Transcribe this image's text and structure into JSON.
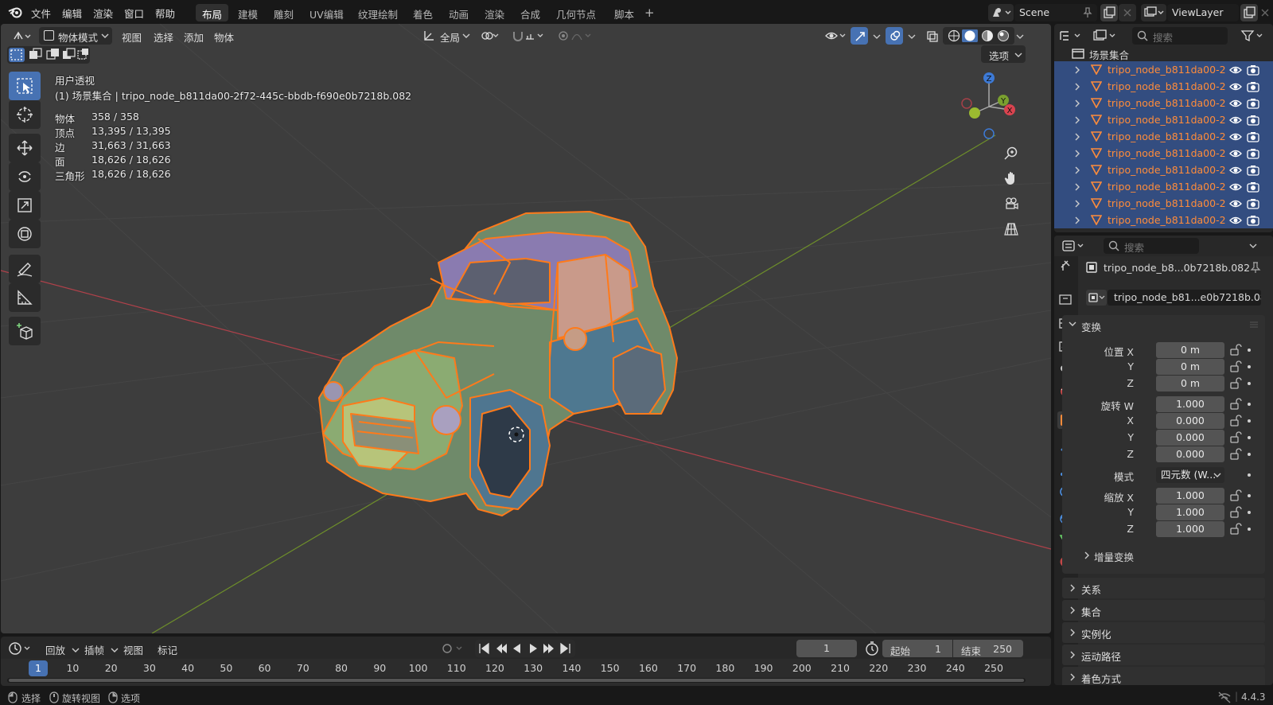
{
  "topbar": {
    "menus": [
      "文件",
      "编辑",
      "渲染",
      "窗口",
      "帮助"
    ],
    "workspaces": [
      "布局",
      "建模",
      "雕刻",
      "UV编辑",
      "纹理绘制",
      "着色",
      "动画",
      "渲染",
      "合成",
      "几何节点",
      "脚本"
    ],
    "active_workspace": "布局",
    "add_workspace": "+",
    "scene": "Scene",
    "view_layer": "ViewLayer"
  },
  "viewport": {
    "mode": "物体模式",
    "menus": [
      "视图",
      "选择",
      "添加",
      "物体"
    ],
    "orientation": "全局",
    "options": "选项",
    "view_name": "用户透视",
    "active_label": "(1) 场景集合 | tripo_node_b811da00-2f72-445c-bbdb-f690e0b7218b.082",
    "stats": [
      {
        "label": "物体",
        "value": "358 / 358"
      },
      {
        "label": "顶点",
        "value": "13,395 / 13,395"
      },
      {
        "label": "边",
        "value": "31,663 / 31,663"
      },
      {
        "label": "面",
        "value": "18,626 / 18,626"
      },
      {
        "label": "三角形",
        "value": "18,626 / 18,626"
      }
    ],
    "gizmo_axes": [
      "Z",
      "Y",
      "X"
    ]
  },
  "outliner": {
    "search_placeholder": "搜索",
    "collection": "场景集合",
    "items": [
      "tripo_node_b811da00-2",
      "tripo_node_b811da00-2",
      "tripo_node_b811da00-2",
      "tripo_node_b811da00-2",
      "tripo_node_b811da00-2",
      "tripo_node_b811da00-2",
      "tripo_node_b811da00-2",
      "tripo_node_b811da00-2",
      "tripo_node_b811da00-2",
      "tripo_node_b811da00-2"
    ]
  },
  "properties": {
    "search_placeholder": "搜索",
    "object_name": "tripo_node_b8...0b7218b.082",
    "object_field": "tripo_node_b81...e0b7218b.082",
    "transform_title": "变换",
    "location": {
      "label": "位置 X",
      "x": "0 m",
      "y": "0 m",
      "z": "0 m"
    },
    "rotation": {
      "label": "旋转 W",
      "w": "1.000",
      "x": "0.000",
      "y": "0.000",
      "z": "0.000"
    },
    "mode_label": "模式",
    "mode_value": "四元数 (W...",
    "scale": {
      "label": "缩放 X",
      "x": "1.000",
      "y": "1.000",
      "z": "1.000"
    },
    "axis_y": "Y",
    "axis_z": "Z",
    "axis_x": "X",
    "delta_transform": "增量变换",
    "panels": [
      "关系",
      "集合",
      "实例化",
      "运动路径",
      "着色方式"
    ]
  },
  "timeline": {
    "playback": "回放",
    "keying": "插帧",
    "view": "视图",
    "marker": "标记",
    "current_frame": "1",
    "start_label": "起始",
    "start_value": "1",
    "end_label": "结束",
    "end_value": "250",
    "ticks": [
      "1",
      "10",
      "20",
      "30",
      "40",
      "50",
      "60",
      "70",
      "80",
      "90",
      "100",
      "110",
      "120",
      "130",
      "140",
      "150",
      "160",
      "170",
      "180",
      "190",
      "200",
      "210",
      "220",
      "230",
      "240",
      "250"
    ]
  },
  "status": {
    "select": "选择",
    "rotate_view": "旋转视图",
    "options": "选项",
    "version": "4.4.3"
  },
  "colors": {
    "selection_outline": "#ff7a1a",
    "active_blue": "#4772b3",
    "x_axis": "#c9433f",
    "y_axis": "#7aa02f",
    "z_axis": "#3d7ad6"
  }
}
